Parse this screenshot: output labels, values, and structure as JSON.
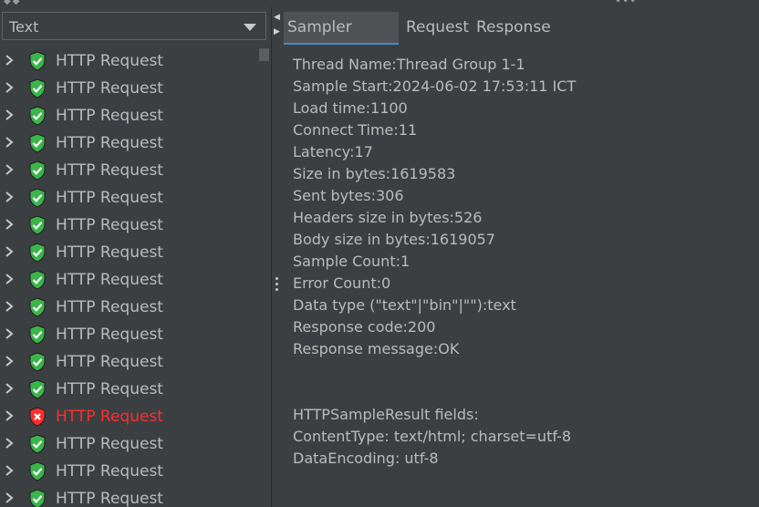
{
  "top_bar": {
    "collapse_arrows": "◆◆",
    "overflow_dots": "•••"
  },
  "left_panel": {
    "renderer_select": {
      "value": "Text"
    },
    "tree_rows": [
      {
        "label": "HTTP Request",
        "status": "success"
      },
      {
        "label": "HTTP Request",
        "status": "success"
      },
      {
        "label": "HTTP Request",
        "status": "success"
      },
      {
        "label": "HTTP Request",
        "status": "success"
      },
      {
        "label": "HTTP Request",
        "status": "success"
      },
      {
        "label": "HTTP Request",
        "status": "success"
      },
      {
        "label": "HTTP Request",
        "status": "success"
      },
      {
        "label": "HTTP Request",
        "status": "success"
      },
      {
        "label": "HTTP Request",
        "status": "success"
      },
      {
        "label": "HTTP Request",
        "status": "success"
      },
      {
        "label": "HTTP Request",
        "status": "success"
      },
      {
        "label": "HTTP Request",
        "status": "success"
      },
      {
        "label": "HTTP Request",
        "status": "success"
      },
      {
        "label": "HTTP Request",
        "status": "error"
      },
      {
        "label": "HTTP Request",
        "status": "success"
      },
      {
        "label": "HTTP Request",
        "status": "success"
      },
      {
        "label": "HTTP Request",
        "status": "success"
      }
    ]
  },
  "right_panel": {
    "tabs": [
      {
        "label": "Sampler result",
        "active": true
      },
      {
        "label": "Request",
        "active": false
      },
      {
        "label": "Response data",
        "active": false
      }
    ],
    "result_lines": [
      "Thread Name:Thread Group 1-1",
      "Sample Start:2024-06-02 17:53:11 ICT",
      "Load time:1100",
      "Connect Time:11",
      "Latency:17",
      "Size in bytes:1619583",
      "Sent bytes:306",
      "Headers size in bytes:526",
      "Body size in bytes:1619057",
      "Sample Count:1",
      "Error Count:0",
      "Data type (\"text\"|\"bin\"|\"\"):text",
      "Response code:200",
      "Response message:OK",
      "",
      "",
      "HTTPSampleResult fields:",
      "ContentType: text/html; charset=utf-8",
      "DataEncoding: utf-8"
    ]
  },
  "colors": {
    "background": "#3c3f41",
    "text": "#bbbbbb",
    "success_green": "#3bb54a",
    "error_red": "#ff2d2d",
    "active_tab": "#4e5254",
    "accent": "#4a88c7"
  }
}
